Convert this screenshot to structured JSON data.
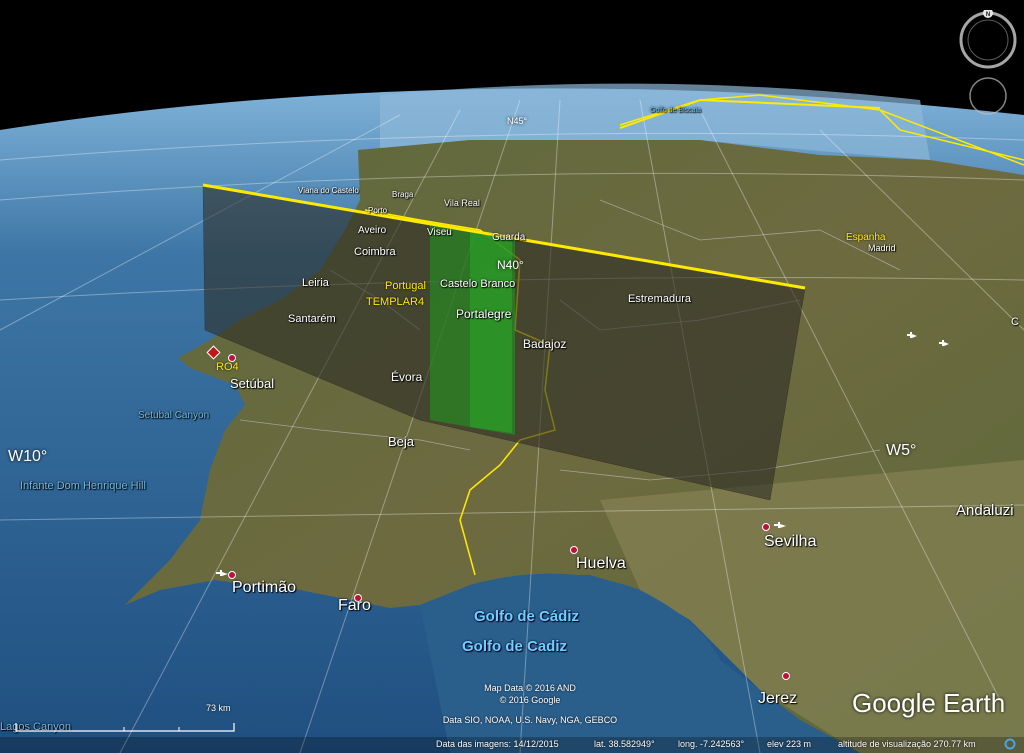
{
  "app": "Google Earth",
  "colors": {
    "space": "#000000",
    "ocean": "#2a5f8c",
    "ocean_deep": "#1b3f66",
    "land": "#6b6a3a",
    "land_dark": "#4a4a2a",
    "grid": "#ffffff",
    "border": "#ffea00",
    "overlay": "#3a3a30",
    "strip": "#23a523",
    "marker": "#c0103a"
  },
  "grid_labels": {
    "lat_n45": "N45°",
    "lat_n40": "N40°",
    "lon_w10": "W10°",
    "lon_w5": "W5°"
  },
  "places": {
    "viana": "Viana do Castelo",
    "braga": "Braga",
    "porto": "Porto",
    "vila_real": "Vila Real",
    "aveiro": "Aveiro",
    "viseu": "Viseu",
    "guarda": "Guarda",
    "coimbra": "Coimbra",
    "leiria": "Leiria",
    "castelo_branco": "Castelo Branco",
    "portugal": "Portugal",
    "templar4": "TEMPLAR4",
    "santarem": "Santarém",
    "portalegre": "Portalegre",
    "estremadura": "Estremadura",
    "badajoz": "Badajoz",
    "evora": "Évora",
    "setubal": "Setúbal",
    "ro4": "RO4",
    "beja": "Beja",
    "espanha": "Espanha",
    "madrid": "Madrid",
    "andaluzia": "Andaluzi",
    "sevilha": "Sevilha",
    "huelva": "Huelva",
    "portimao": "Portimão",
    "faro": "Faro",
    "jerez": "Jerez",
    "cadiz_pt": "Golfo de Cádiz",
    "cadiz_es": "Golfo de Cadiz",
    "setubal_canyon": "Setubal Canyon",
    "infante": "Infante Dom Henrique Hill",
    "lagos_canyon": "Lagos Canyon",
    "biscay": "Golfo de Biscaia",
    "edge_c": "C"
  },
  "scale": {
    "label": "73 km"
  },
  "credits": {
    "line1": "Map Data © 2016 AND",
    "line2": "© 2016 Google",
    "line3": "Data SIO, NOAA, U.S. Navy, NGA, GEBCO"
  },
  "status": {
    "imagery_date": "Data das imagens: 14/12/2015",
    "lat": "lat.   38.582949°",
    "lon": "long.   -7.242563°",
    "elev": "elev   223 m",
    "eye_alt": "altitude de visualização 270.77 km"
  },
  "logo": "Google Earth",
  "compass": {
    "north": "N"
  }
}
